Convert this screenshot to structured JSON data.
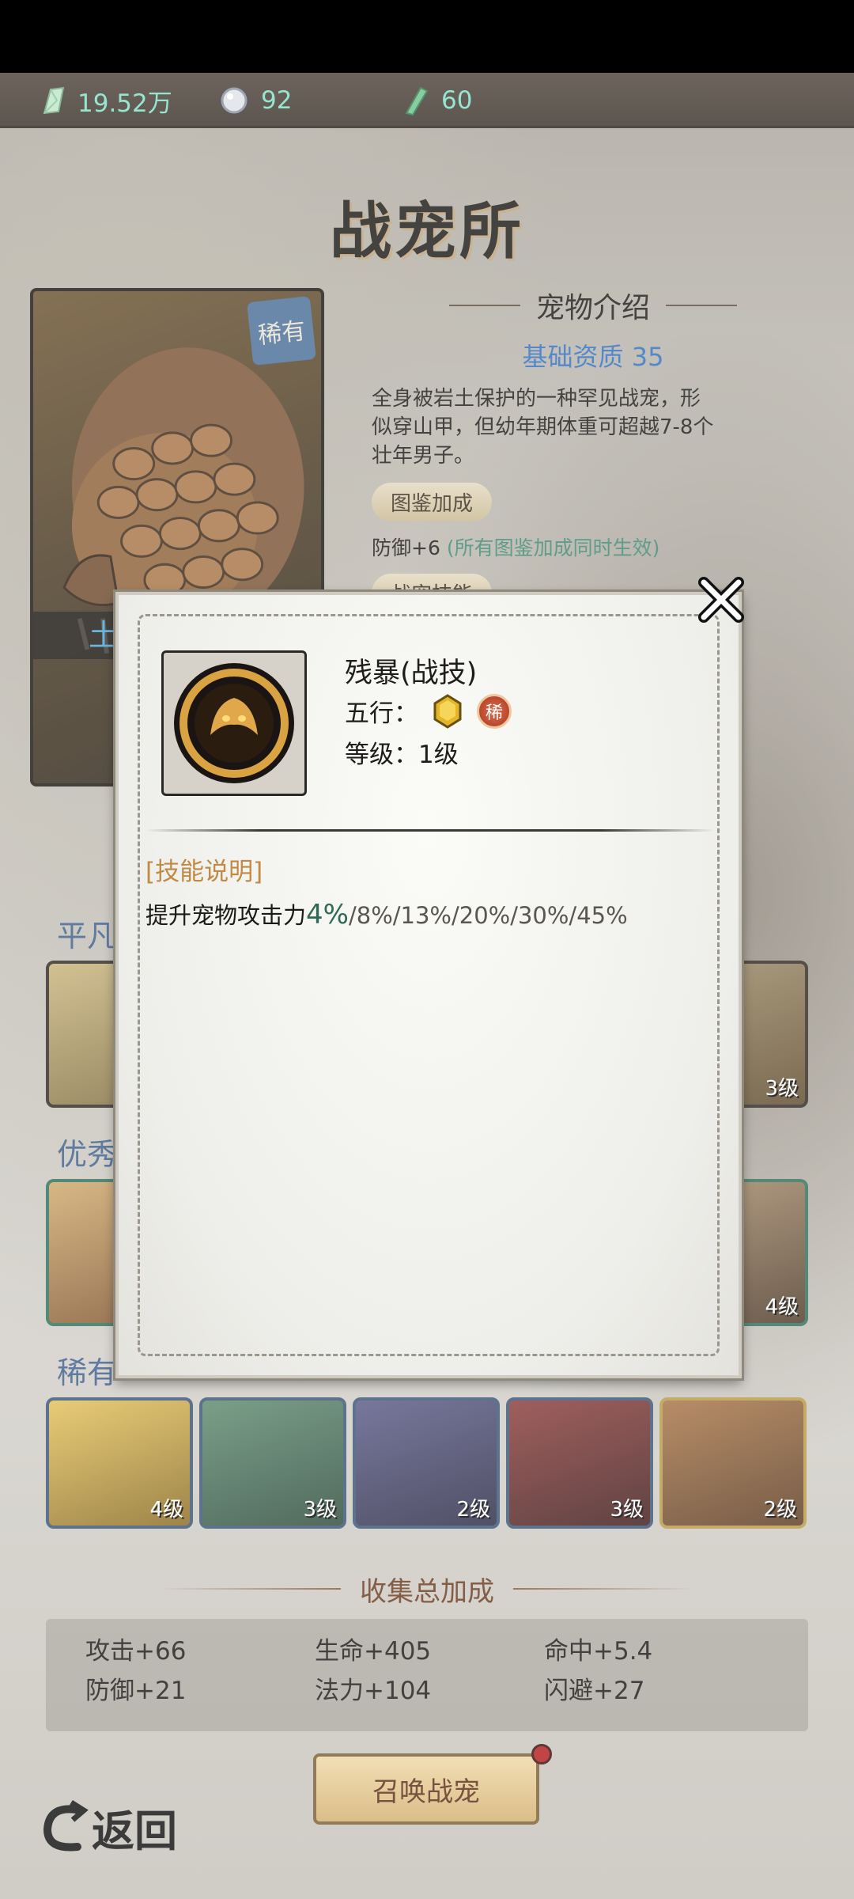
{
  "resources": [
    {
      "icon": "jade-icon",
      "value": "19.52万"
    },
    {
      "icon": "pearl-icon",
      "value": "92"
    },
    {
      "icon": "token-icon",
      "value": "60"
    }
  ],
  "page_title": "战宠所",
  "pet_card": {
    "rarity": "稀有",
    "name_partial": "土"
  },
  "intro": {
    "heading": "宠物介绍",
    "quality": "基础资质 35",
    "description": "全身被岩土保护的一种罕见战宠，形似穿山甲，但幼年期体重可超越7-8个壮年男子。",
    "codex_button": "图鉴加成",
    "bonus_main": "防御+6",
    "bonus_note": "(所有图鉴加成同时生效)",
    "skill_button": "战宠技能"
  },
  "rows": {
    "common_label": "平凡",
    "excellent_label": "优秀",
    "rare_label": "稀有",
    "common_tiles": [
      {
        "level": ""
      },
      {
        "level": "3级"
      }
    ],
    "excellent_tiles": [
      {
        "level": ""
      },
      {
        "level": "4级"
      }
    ],
    "rare_tiles": [
      {
        "level": "4级"
      },
      {
        "level": "3级"
      },
      {
        "level": "2级"
      },
      {
        "level": "3级"
      },
      {
        "level": "2级"
      }
    ]
  },
  "collection": {
    "heading": "收集总加成",
    "stats": [
      "攻击+66",
      "生命+405",
      "命中+5.4",
      "防御+21",
      "法力+104",
      "闪避+27"
    ]
  },
  "summon_button": "召唤战宠",
  "back_label": "返回",
  "modal": {
    "skill_name": "残暴(战技)",
    "element_label": "五行：",
    "rarity_badge": "稀",
    "level_text": "等级：1级",
    "section_title": "[技能说明]",
    "desc_prefix": "提升宠物攻击力",
    "desc_current": "4%",
    "desc_rest": "/8%/13%/20%/30%/45%"
  },
  "colors": {
    "resource_text": "#7fe0c6",
    "quality_blue": "#2f6fbe",
    "section_gold": "#c08a45",
    "highlight_green": "#2f6a58"
  }
}
